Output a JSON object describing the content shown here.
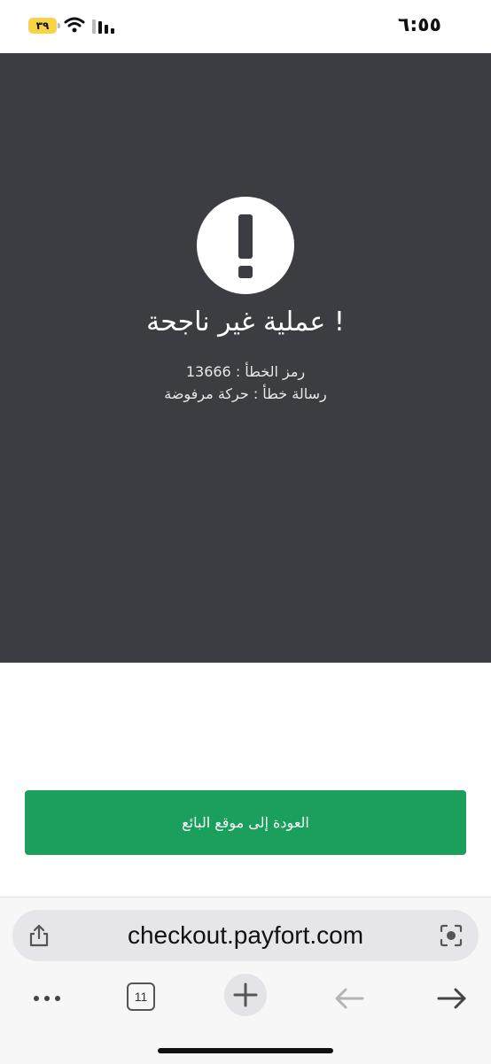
{
  "status_bar": {
    "time": "٦:٥٥",
    "battery": "٣٩"
  },
  "error": {
    "title": "! عملية غير ناجحة",
    "code_line": "رمز الخطأ : 13666",
    "message_line": "رسالة خطأ : حركة مرفوضة"
  },
  "actions": {
    "back_to_merchant": "العودة إلى موقع البائع"
  },
  "browser": {
    "url": "checkout.payfort.com",
    "tab_count": "11"
  }
}
